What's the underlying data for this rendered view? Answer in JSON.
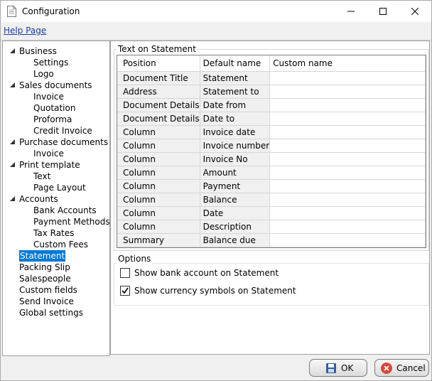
{
  "window": {
    "title": "Configuration"
  },
  "menu": {
    "help": "Help Page"
  },
  "nav": {
    "items": [
      {
        "label": "Business",
        "level": 0,
        "expanded": true
      },
      {
        "label": "Settings",
        "level": 1
      },
      {
        "label": "Logo",
        "level": 1
      },
      {
        "label": "Sales documents",
        "level": 0,
        "expanded": true
      },
      {
        "label": "Invoice",
        "level": 1
      },
      {
        "label": "Quotation",
        "level": 1
      },
      {
        "label": "Proforma",
        "level": 1
      },
      {
        "label": "Credit Invoice",
        "level": 1
      },
      {
        "label": "Purchase documents",
        "level": 0,
        "expanded": true
      },
      {
        "label": "Invoice",
        "level": 1
      },
      {
        "label": "Print template",
        "level": 0,
        "expanded": true
      },
      {
        "label": "Text",
        "level": 1
      },
      {
        "label": "Page Layout",
        "level": 1
      },
      {
        "label": "Accounts",
        "level": 0,
        "expanded": true
      },
      {
        "label": "Bank Accounts",
        "level": 1
      },
      {
        "label": "Payment Methods",
        "level": 1
      },
      {
        "label": "Tax Rates",
        "level": 1
      },
      {
        "label": "Custom Fees",
        "level": 1
      },
      {
        "label": "Statement",
        "level": 0,
        "selected": true
      },
      {
        "label": "Packing Slip",
        "level": 0
      },
      {
        "label": "Salespeople",
        "level": 0
      },
      {
        "label": "Custom fields",
        "level": 0
      },
      {
        "label": "Send Invoice",
        "level": 0
      },
      {
        "label": "Global settings",
        "level": 0
      }
    ]
  },
  "statement": {
    "group_title": "Text on Statement",
    "columns": [
      "Position",
      "Default name",
      "Custom name"
    ],
    "rows": [
      [
        "Document Title",
        "Statement",
        ""
      ],
      [
        "Address",
        "Statement to",
        ""
      ],
      [
        "Document Details",
        "Date from",
        ""
      ],
      [
        "Document Details",
        "Date to",
        ""
      ],
      [
        "Column",
        "Invoice date",
        ""
      ],
      [
        "Column",
        "Invoice number",
        ""
      ],
      [
        "Column",
        "Invoice No",
        ""
      ],
      [
        "Column",
        "Amount",
        ""
      ],
      [
        "Column",
        "Payment",
        ""
      ],
      [
        "Column",
        "Balance",
        ""
      ],
      [
        "Column",
        "Date",
        ""
      ],
      [
        "Column",
        "Description",
        ""
      ],
      [
        "Summary",
        "Balance due",
        ""
      ]
    ]
  },
  "options": {
    "group_title": "Options",
    "show_bank_account": {
      "label": "Show bank account on Statement",
      "checked": false
    },
    "show_currency_symbols": {
      "label": "Show currency symbols on Statement",
      "checked": true
    }
  },
  "buttons": {
    "ok": "OK",
    "cancel": "Cancel"
  },
  "colors": {
    "selection": "#0078d7",
    "link": "#1a3da6",
    "cancel_icon": "#d9463a",
    "ok_icon": "#2e5fa8"
  }
}
